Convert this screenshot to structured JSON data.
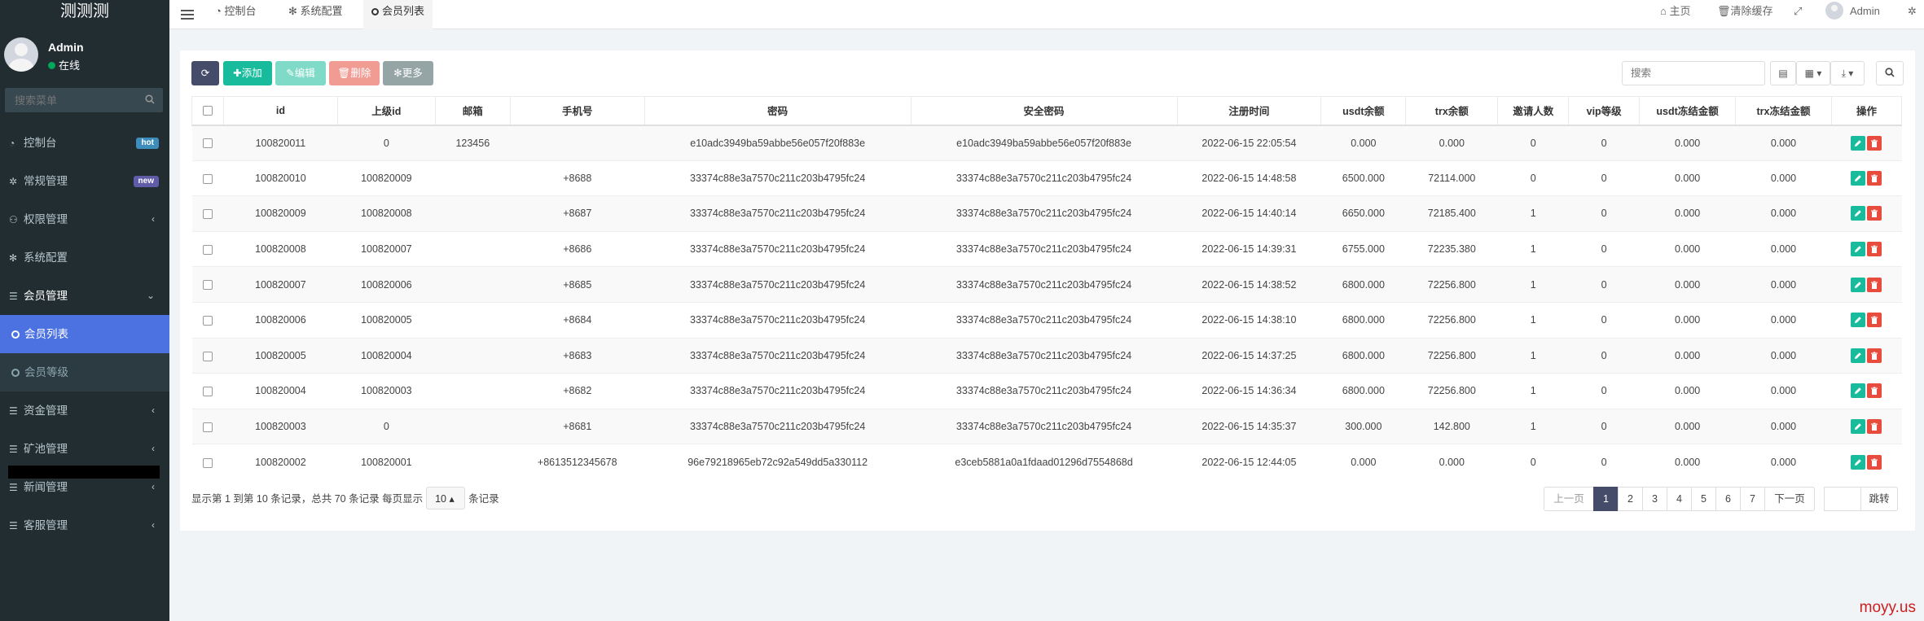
{
  "brand": "测测测",
  "user": {
    "name": "Admin",
    "status": "在线"
  },
  "sidebar": {
    "search_placeholder": "搜索菜单",
    "items": [
      {
        "label": "控制台",
        "icon": "dashboard-icon",
        "badge": "hot"
      },
      {
        "label": "常规管理",
        "icon": "cogs-icon",
        "badge": "new"
      },
      {
        "label": "权限管理",
        "icon": "users-icon"
      },
      {
        "label": "系统配置",
        "icon": "cog-icon"
      },
      {
        "label": "会员管理",
        "icon": "list-icon"
      },
      {
        "label": "会员列表",
        "icon": "circle-icon"
      },
      {
        "label": "会员等级",
        "icon": "circle-icon"
      },
      {
        "label": "资金管理",
        "icon": "list-icon"
      },
      {
        "label": "矿池管理",
        "icon": "list-icon"
      },
      {
        "label": "新闻管理",
        "icon": "list-icon"
      },
      {
        "label": "客服管理",
        "icon": "list-icon"
      }
    ]
  },
  "topnav": {
    "tabs": [
      "控制台",
      "系统配置",
      "会员列表"
    ],
    "home": "主页",
    "clear_cache": "清除缓存",
    "admin": "Admin"
  },
  "toolbar": {
    "add": "添加",
    "edit": "编辑",
    "delete": "删除",
    "more": "更多",
    "search_placeholder": "搜索"
  },
  "table": {
    "columns": [
      "id",
      "上级id",
      "邮箱",
      "手机号",
      "密码",
      "安全密码",
      "注册时间",
      "usdt余额",
      "trx余额",
      "邀请人数",
      "vip等级",
      "usdt冻结金额",
      "trx冻结金额",
      "操作"
    ],
    "rows": [
      [
        "100820011",
        "0",
        "123456",
        "",
        "e10adc3949ba59abbe56e057f20f883e",
        "e10adc3949ba59abbe56e057f20f883e",
        "2022-06-15 22:05:54",
        "0.000",
        "0.000",
        "0",
        "0",
        "0.000",
        "0.000"
      ],
      [
        "100820010",
        "100820009",
        "",
        "+8688",
        "33374c88e3a7570c211c203b4795fc24",
        "33374c88e3a7570c211c203b4795fc24",
        "2022-06-15 14:48:58",
        "6500.000",
        "72114.000",
        "0",
        "0",
        "0.000",
        "0.000"
      ],
      [
        "100820009",
        "100820008",
        "",
        "+8687",
        "33374c88e3a7570c211c203b4795fc24",
        "33374c88e3a7570c211c203b4795fc24",
        "2022-06-15 14:40:14",
        "6650.000",
        "72185.400",
        "1",
        "0",
        "0.000",
        "0.000"
      ],
      [
        "100820008",
        "100820007",
        "",
        "+8686",
        "33374c88e3a7570c211c203b4795fc24",
        "33374c88e3a7570c211c203b4795fc24",
        "2022-06-15 14:39:31",
        "6755.000",
        "72235.380",
        "1",
        "0",
        "0.000",
        "0.000"
      ],
      [
        "100820007",
        "100820006",
        "",
        "+8685",
        "33374c88e3a7570c211c203b4795fc24",
        "33374c88e3a7570c211c203b4795fc24",
        "2022-06-15 14:38:52",
        "6800.000",
        "72256.800",
        "1",
        "0",
        "0.000",
        "0.000"
      ],
      [
        "100820006",
        "100820005",
        "",
        "+8684",
        "33374c88e3a7570c211c203b4795fc24",
        "33374c88e3a7570c211c203b4795fc24",
        "2022-06-15 14:38:10",
        "6800.000",
        "72256.800",
        "1",
        "0",
        "0.000",
        "0.000"
      ],
      [
        "100820005",
        "100820004",
        "",
        "+8683",
        "33374c88e3a7570c211c203b4795fc24",
        "33374c88e3a7570c211c203b4795fc24",
        "2022-06-15 14:37:25",
        "6800.000",
        "72256.800",
        "1",
        "0",
        "0.000",
        "0.000"
      ],
      [
        "100820004",
        "100820003",
        "",
        "+8682",
        "33374c88e3a7570c211c203b4795fc24",
        "33374c88e3a7570c211c203b4795fc24",
        "2022-06-15 14:36:34",
        "6800.000",
        "72256.800",
        "1",
        "0",
        "0.000",
        "0.000"
      ],
      [
        "100820003",
        "0",
        "",
        "+8681",
        "33374c88e3a7570c211c203b4795fc24",
        "33374c88e3a7570c211c203b4795fc24",
        "2022-06-15 14:35:37",
        "300.000",
        "142.800",
        "1",
        "0",
        "0.000",
        "0.000"
      ],
      [
        "100820002",
        "100820001",
        "",
        "+8613512345678",
        "96e79218965eb72c92a549dd5a330112",
        "e3ceb5881a0a1fdaad01296d7554868d",
        "2022-06-15 12:44:05",
        "0.000",
        "0.000",
        "0",
        "0",
        "0.000",
        "0.000"
      ]
    ]
  },
  "footer": {
    "summary_prefix": "显示第 1 到第 10 条记录，总共 70 条记录 每页显示",
    "page_size": "10",
    "summary_suffix": "条记录",
    "prev": "上一页",
    "pages": [
      "1",
      "2",
      "3",
      "4",
      "5",
      "6",
      "7"
    ],
    "next": "下一页",
    "goto": "跳转"
  },
  "watermark": "moyy.us",
  "colors": {
    "sidebar_bg": "#222d32",
    "active_menu": "#4b72e0",
    "primary": "#444c69",
    "success": "#18bc9c",
    "danger": "#e74c3c"
  }
}
